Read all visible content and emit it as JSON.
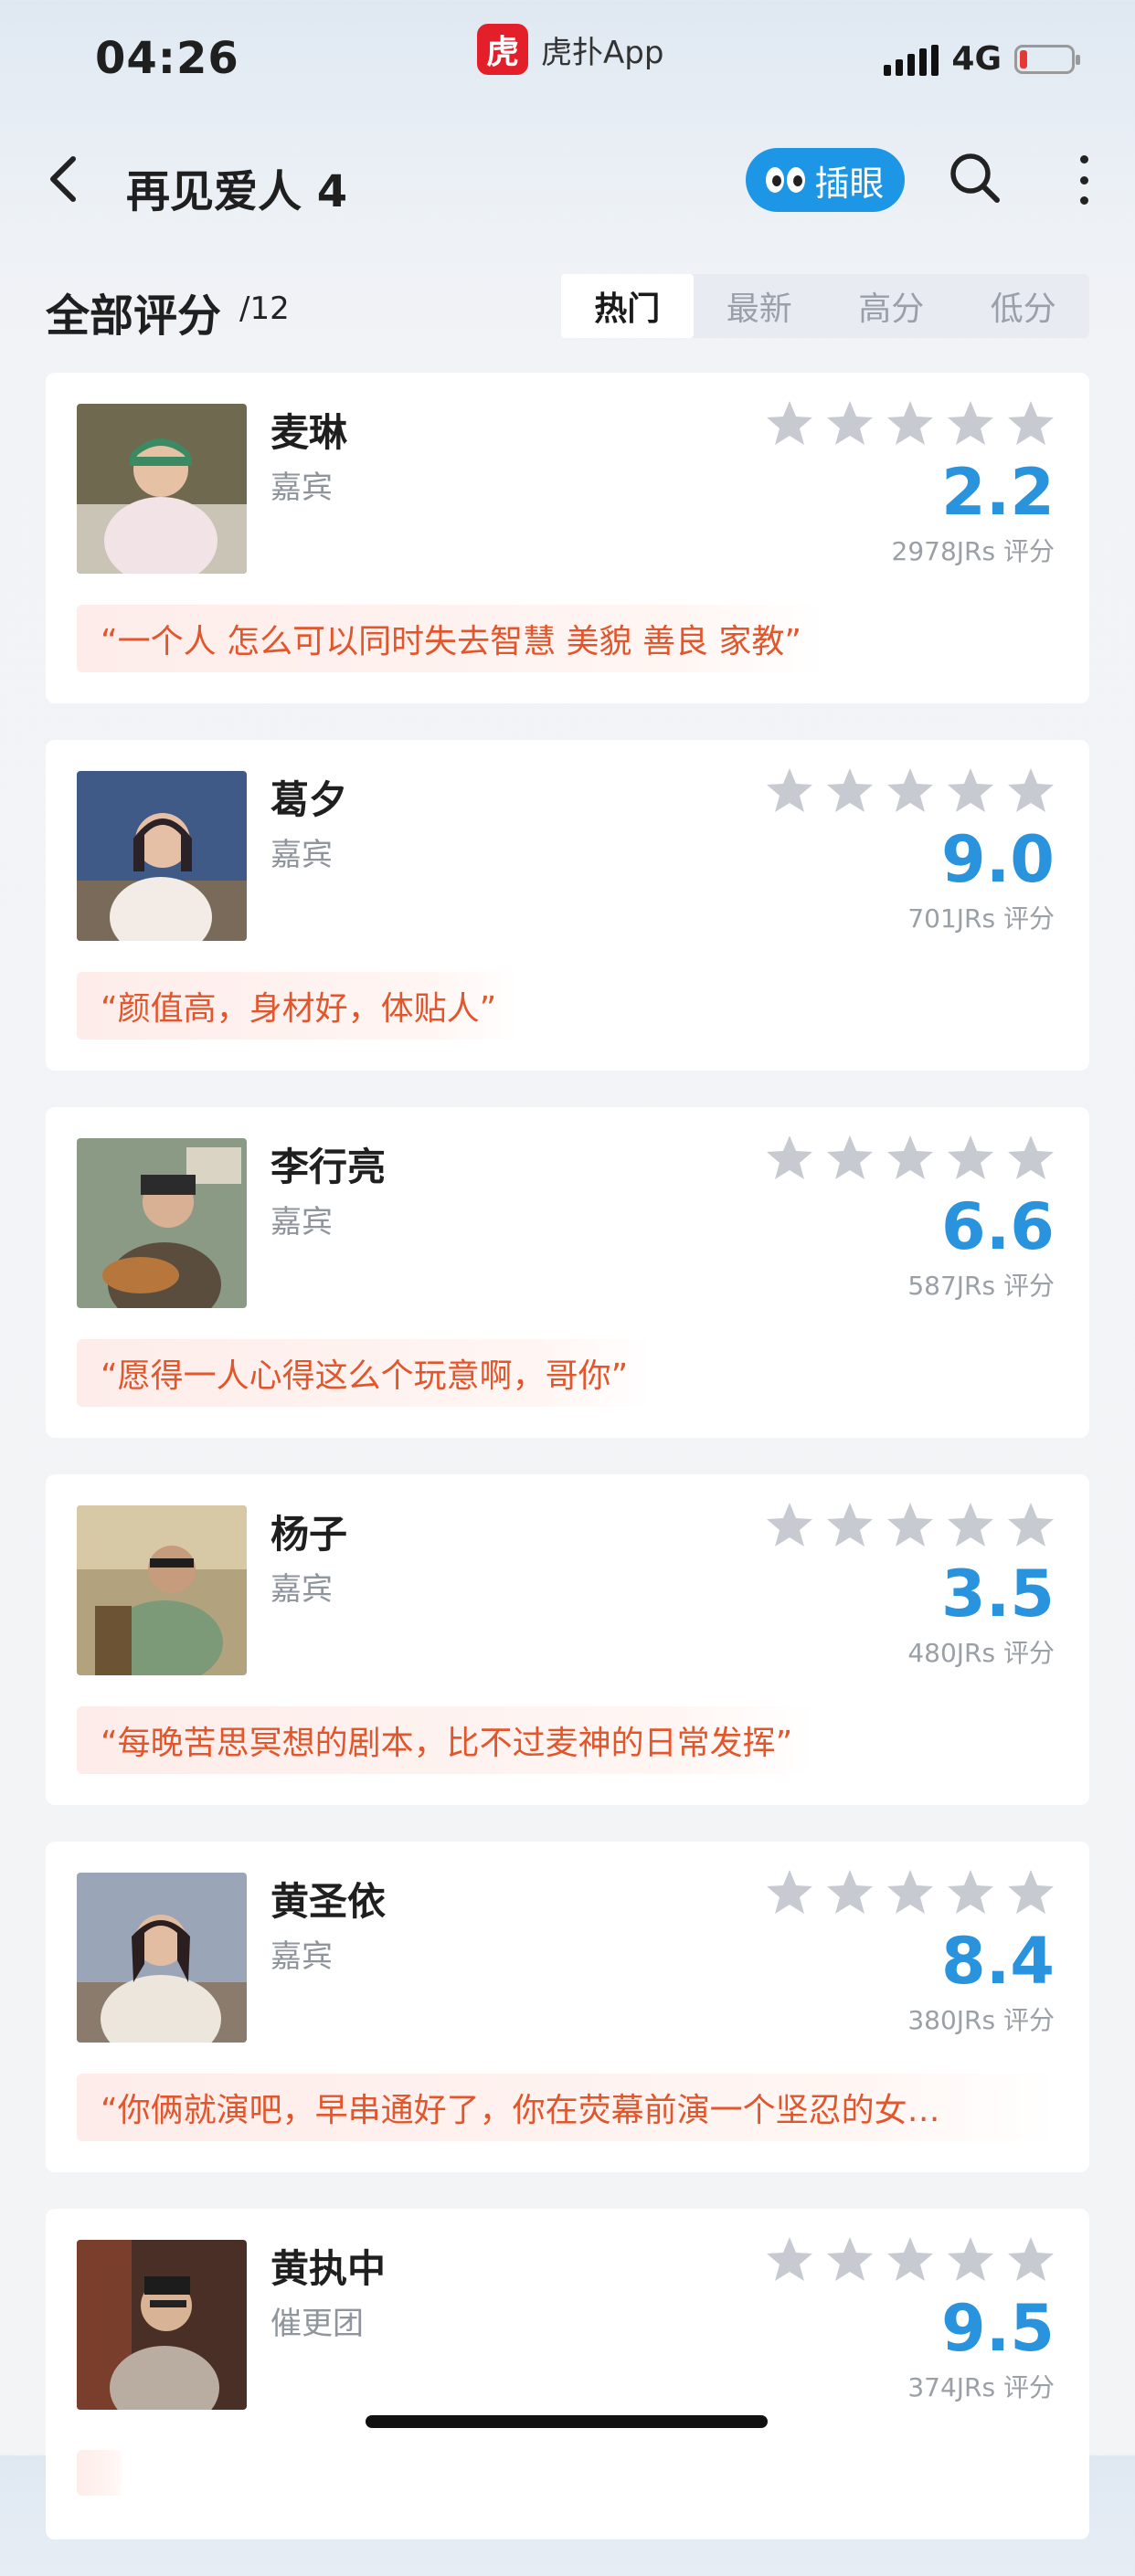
{
  "status_bar": {
    "time": "04:26",
    "app_logo_text": "虎",
    "app_name": "虎扑App",
    "network": "4G",
    "battery_color": "#e53935"
  },
  "header": {
    "title": "再见爱人 4",
    "cha_yan_label": "插眼",
    "accent": "#1e96e6"
  },
  "section": {
    "label": "全部评分",
    "count": "/12",
    "tabs": [
      {
        "label": "热门",
        "active": true
      },
      {
        "label": "最新",
        "active": false
      },
      {
        "label": "高分",
        "active": false
      },
      {
        "label": "低分",
        "active": false
      }
    ]
  },
  "cards": [
    {
      "name": "麦琳",
      "role": "嘉宾",
      "score": "2.2",
      "votes": "2978JRs 评分",
      "quote": "“一个人 怎么可以同时失去智慧 美貌 善良 家教”"
    },
    {
      "name": "葛夕",
      "role": "嘉宾",
      "score": "9.0",
      "votes": "701JRs 评分",
      "quote": "“颜值高，身材好，体贴人”"
    },
    {
      "name": "李行亮",
      "role": "嘉宾",
      "score": "6.6",
      "votes": "587JRs 评分",
      "quote": "“愿得一人心得这么个玩意啊，哥你”"
    },
    {
      "name": "杨子",
      "role": "嘉宾",
      "score": "3.5",
      "votes": "480JRs 评分",
      "quote": "“每晚苦思冥想的剧本，比不过麦神的日常发挥”"
    },
    {
      "name": "黄圣依",
      "role": "嘉宾",
      "score": "8.4",
      "votes": "380JRs 评分",
      "quote": "“你俩就演吧，早串通好了，你在荧幕前演一个坚忍的女…"
    },
    {
      "name": "黄执中",
      "role": "催更团",
      "score": "9.5",
      "votes": "374JRs 评分",
      "quote": ""
    }
  ],
  "colors": {
    "score": "#2a93dd",
    "quote_text": "#e3562c",
    "star_grey": "#c7cbd1"
  }
}
